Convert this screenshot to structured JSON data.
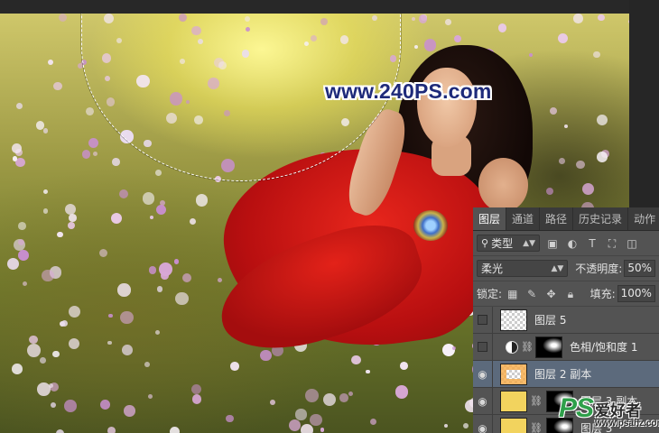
{
  "watermark": {
    "site": "www.240PS.com"
  },
  "layers_panel": {
    "tabs": [
      "图层",
      "通道",
      "路径",
      "历史记录",
      "动作"
    ],
    "active_tab": 0,
    "filter": {
      "kind": "类型"
    },
    "blend_mode": "柔光",
    "opacity": {
      "label": "不透明度:",
      "value": "50%"
    },
    "lock": {
      "label": "锁定:"
    },
    "fill": {
      "label": "填充:",
      "value": "100%"
    },
    "layers": [
      {
        "name": "图层 5",
        "visible": false,
        "thumbnail": "transparent"
      },
      {
        "name": "色相/饱和度 1",
        "visible": false,
        "thumbnail": "adjustment"
      },
      {
        "name": "图层 2 副本",
        "visible": true,
        "selected": true,
        "thumbnail": "transparent-orange"
      },
      {
        "name": "图层 3 副本",
        "visible": true,
        "thumbnail": "yellow-with-mask"
      },
      {
        "name": "图层 3",
        "visible": true,
        "thumbnail": "yellow-with-mask"
      }
    ]
  },
  "logo": {
    "mark": "PS",
    "name": "爱好者",
    "url": "www.psahz.com"
  },
  "colors": {
    "panel_bg": "#535353",
    "selected_row": "#5c6a7c",
    "dress_red": "#d41a15",
    "watermark_blue": "#1e2a7a"
  }
}
